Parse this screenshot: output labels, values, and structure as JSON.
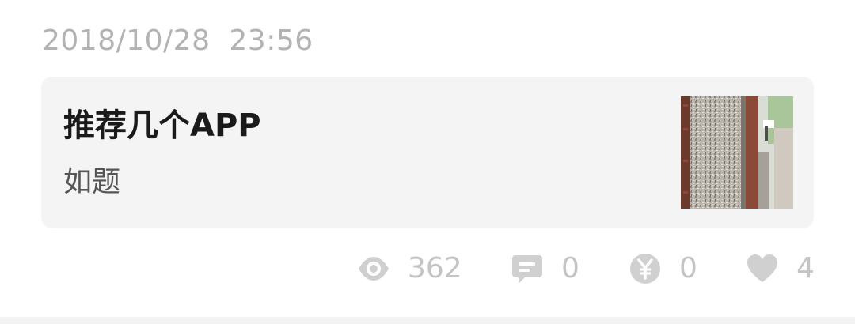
{
  "post": {
    "date": "2018/10/28",
    "time": "23:56",
    "title": "推荐几个APP",
    "description": "如题"
  },
  "stats": {
    "views": {
      "icon": "eye-icon",
      "count": "362"
    },
    "comments": {
      "icon": "comment-icon",
      "count": "0"
    },
    "rewards": {
      "icon": "yen-coin-icon",
      "count": "0"
    },
    "likes": {
      "icon": "heart-icon",
      "count": "4"
    }
  },
  "colors": {
    "timestamp": "#b3b3b3",
    "card_background": "#f4f4f4",
    "title": "#1a1a1a",
    "description": "#555555",
    "stat_icon": "#d0d0d0",
    "stat_text": "#c4c4c4"
  }
}
